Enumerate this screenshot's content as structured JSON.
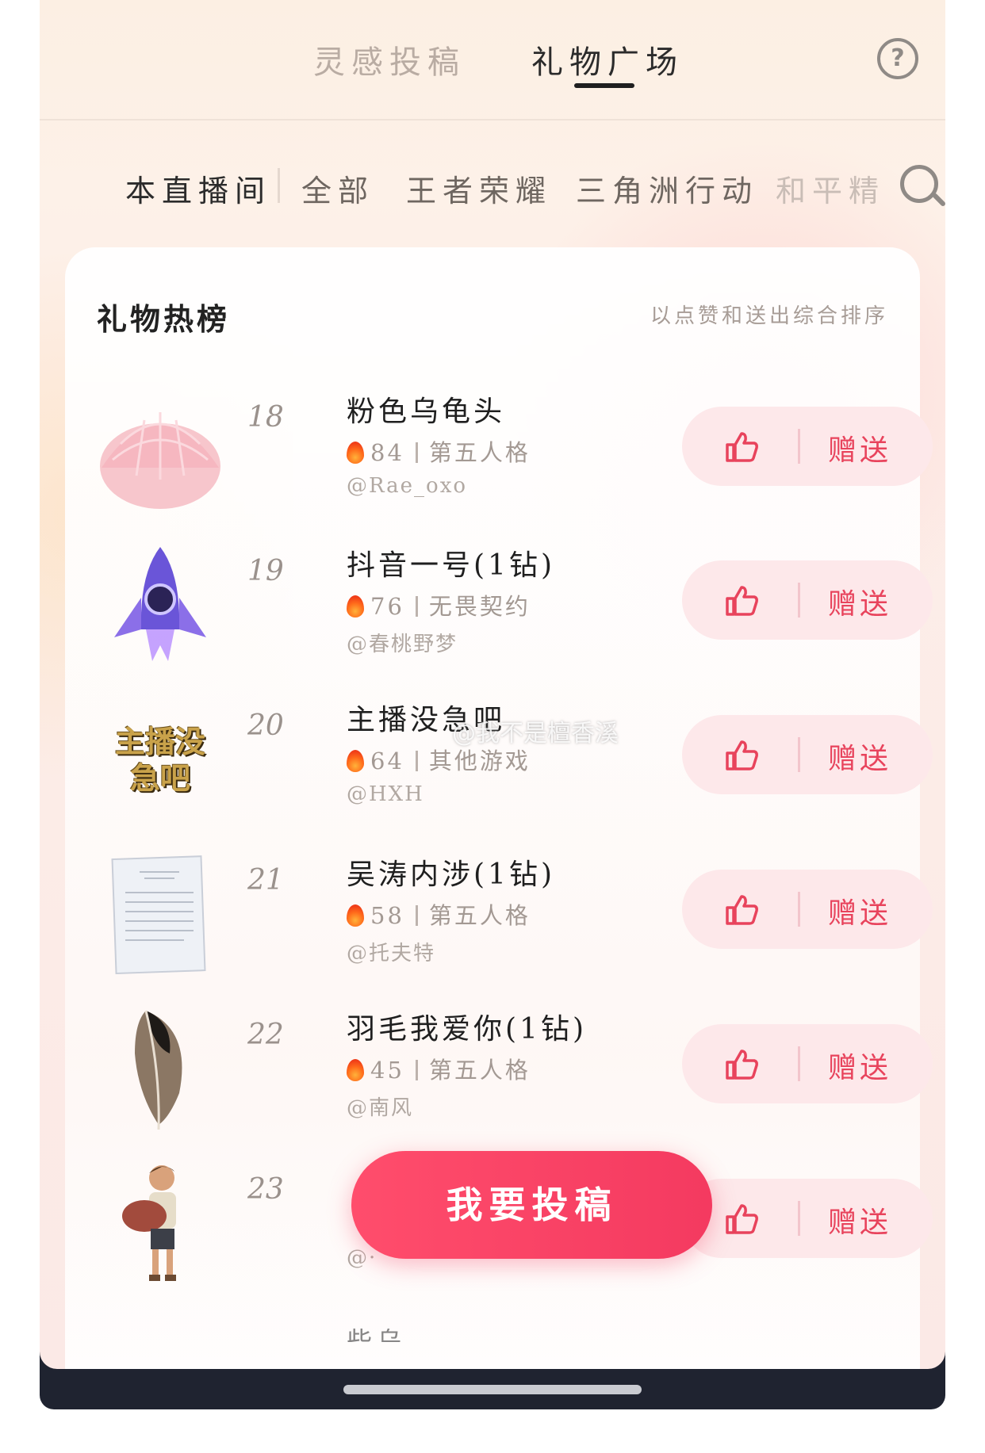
{
  "tabs": {
    "inspiration": "灵感投稿",
    "gift_square": "礼物广场"
  },
  "categories": [
    "本直播间",
    "全部",
    "王者荣耀",
    "三角洲行动",
    "和平精"
  ],
  "card": {
    "title": "礼物热榜",
    "note": "以点赞和送出综合排序"
  },
  "items": [
    {
      "rank": "18",
      "name": "粉色乌龟头",
      "likes": "84",
      "game": "第五人格",
      "author": "@Rae_oxo",
      "thumb_icon": "pink-shell-icon"
    },
    {
      "rank": "19",
      "name": "抖音一号(1钻)",
      "likes": "76",
      "game": "无畏契约",
      "author": "@春桃野梦",
      "thumb_icon": "rocket-icon"
    },
    {
      "rank": "20",
      "name": "主播没急吧",
      "likes": "64",
      "game": "其他游戏",
      "author": "@HXH",
      "thumb_icon": "text-badge-icon",
      "thumb_text": "主播没急吧"
    },
    {
      "rank": "21",
      "name": "吴涛内涉(1钻)",
      "likes": "58",
      "game": "第五人格",
      "author": "@托夫特",
      "thumb_icon": "document-icon"
    },
    {
      "rank": "22",
      "name": "羽毛我爱你(1钻)",
      "likes": "45",
      "game": "第五人格",
      "author": "@南风",
      "thumb_icon": "feather-icon"
    },
    {
      "rank": "23",
      "name": "",
      "likes": "",
      "game": "",
      "author": "@·",
      "thumb_icon": "boy-figure-icon"
    }
  ],
  "peek_text": "些乌…",
  "actions": {
    "gift_label": "赠送"
  },
  "fab": {
    "label": "我要投稿"
  },
  "watermark": "@我不是檀香溪",
  "colors": {
    "accent": "#f43a60",
    "like_pink": "#e8435c",
    "action_bg": "#fde8ea"
  }
}
